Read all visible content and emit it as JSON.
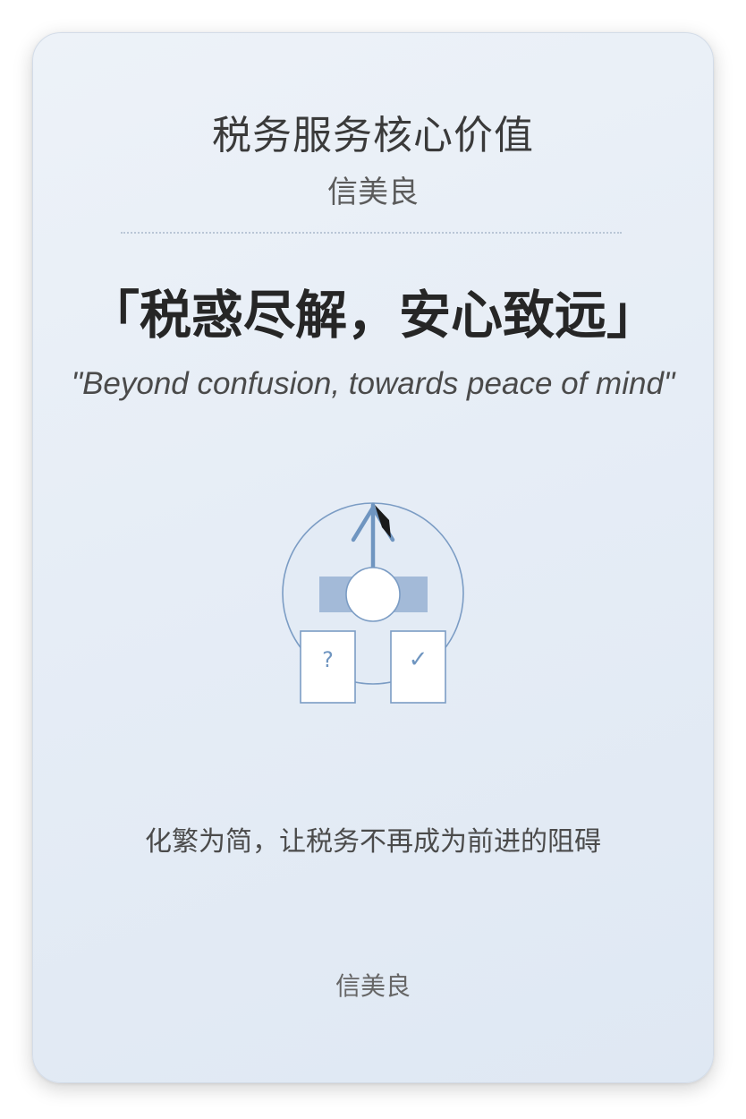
{
  "card": {
    "title": "税务服务核心价值",
    "subtitle": "信美良",
    "slogan": "「税惑尽解，安心致远」",
    "slogan_en": "\"Beyond confusion, towards peace of mind\"",
    "illustration": {
      "icons": [
        "upward-arrow-icon",
        "question-card-icon",
        "check-card-icon"
      ],
      "question_mark": "?",
      "check_mark": "✓",
      "accent_color": "#6f95c0",
      "bar_color": "#a3bad8"
    },
    "tagline": "化繁为简，让税务不再成为前进的阻碍",
    "footer": "信美良"
  }
}
